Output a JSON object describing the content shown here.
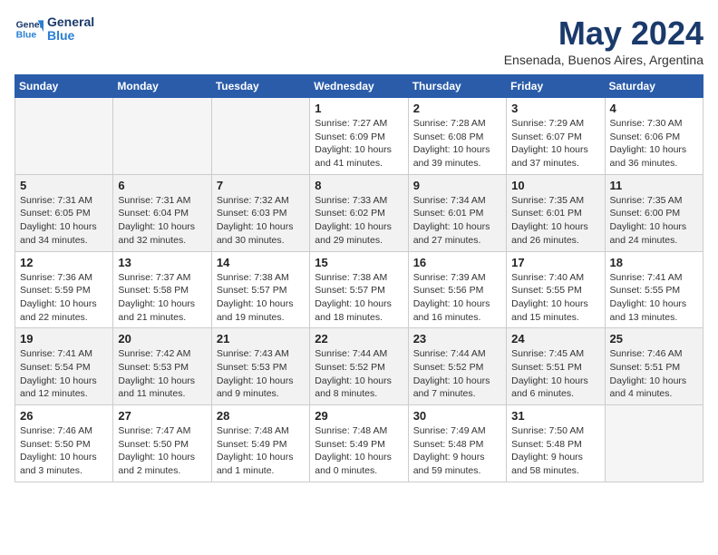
{
  "logo": {
    "text_general": "General",
    "text_blue": "Blue"
  },
  "title": "May 2024",
  "subtitle": "Ensenada, Buenos Aires, Argentina",
  "days_of_week": [
    "Sunday",
    "Monday",
    "Tuesday",
    "Wednesday",
    "Thursday",
    "Friday",
    "Saturday"
  ],
  "weeks": [
    {
      "alt": false,
      "days": [
        {
          "num": "",
          "info": ""
        },
        {
          "num": "",
          "info": ""
        },
        {
          "num": "",
          "info": ""
        },
        {
          "num": "1",
          "info": "Sunrise: 7:27 AM\nSunset: 6:09 PM\nDaylight: 10 hours\nand 41 minutes."
        },
        {
          "num": "2",
          "info": "Sunrise: 7:28 AM\nSunset: 6:08 PM\nDaylight: 10 hours\nand 39 minutes."
        },
        {
          "num": "3",
          "info": "Sunrise: 7:29 AM\nSunset: 6:07 PM\nDaylight: 10 hours\nand 37 minutes."
        },
        {
          "num": "4",
          "info": "Sunrise: 7:30 AM\nSunset: 6:06 PM\nDaylight: 10 hours\nand 36 minutes."
        }
      ]
    },
    {
      "alt": true,
      "days": [
        {
          "num": "5",
          "info": "Sunrise: 7:31 AM\nSunset: 6:05 PM\nDaylight: 10 hours\nand 34 minutes."
        },
        {
          "num": "6",
          "info": "Sunrise: 7:31 AM\nSunset: 6:04 PM\nDaylight: 10 hours\nand 32 minutes."
        },
        {
          "num": "7",
          "info": "Sunrise: 7:32 AM\nSunset: 6:03 PM\nDaylight: 10 hours\nand 30 minutes."
        },
        {
          "num": "8",
          "info": "Sunrise: 7:33 AM\nSunset: 6:02 PM\nDaylight: 10 hours\nand 29 minutes."
        },
        {
          "num": "9",
          "info": "Sunrise: 7:34 AM\nSunset: 6:01 PM\nDaylight: 10 hours\nand 27 minutes."
        },
        {
          "num": "10",
          "info": "Sunrise: 7:35 AM\nSunset: 6:01 PM\nDaylight: 10 hours\nand 26 minutes."
        },
        {
          "num": "11",
          "info": "Sunrise: 7:35 AM\nSunset: 6:00 PM\nDaylight: 10 hours\nand 24 minutes."
        }
      ]
    },
    {
      "alt": false,
      "days": [
        {
          "num": "12",
          "info": "Sunrise: 7:36 AM\nSunset: 5:59 PM\nDaylight: 10 hours\nand 22 minutes."
        },
        {
          "num": "13",
          "info": "Sunrise: 7:37 AM\nSunset: 5:58 PM\nDaylight: 10 hours\nand 21 minutes."
        },
        {
          "num": "14",
          "info": "Sunrise: 7:38 AM\nSunset: 5:57 PM\nDaylight: 10 hours\nand 19 minutes."
        },
        {
          "num": "15",
          "info": "Sunrise: 7:38 AM\nSunset: 5:57 PM\nDaylight: 10 hours\nand 18 minutes."
        },
        {
          "num": "16",
          "info": "Sunrise: 7:39 AM\nSunset: 5:56 PM\nDaylight: 10 hours\nand 16 minutes."
        },
        {
          "num": "17",
          "info": "Sunrise: 7:40 AM\nSunset: 5:55 PM\nDaylight: 10 hours\nand 15 minutes."
        },
        {
          "num": "18",
          "info": "Sunrise: 7:41 AM\nSunset: 5:55 PM\nDaylight: 10 hours\nand 13 minutes."
        }
      ]
    },
    {
      "alt": true,
      "days": [
        {
          "num": "19",
          "info": "Sunrise: 7:41 AM\nSunset: 5:54 PM\nDaylight: 10 hours\nand 12 minutes."
        },
        {
          "num": "20",
          "info": "Sunrise: 7:42 AM\nSunset: 5:53 PM\nDaylight: 10 hours\nand 11 minutes."
        },
        {
          "num": "21",
          "info": "Sunrise: 7:43 AM\nSunset: 5:53 PM\nDaylight: 10 hours\nand 9 minutes."
        },
        {
          "num": "22",
          "info": "Sunrise: 7:44 AM\nSunset: 5:52 PM\nDaylight: 10 hours\nand 8 minutes."
        },
        {
          "num": "23",
          "info": "Sunrise: 7:44 AM\nSunset: 5:52 PM\nDaylight: 10 hours\nand 7 minutes."
        },
        {
          "num": "24",
          "info": "Sunrise: 7:45 AM\nSunset: 5:51 PM\nDaylight: 10 hours\nand 6 minutes."
        },
        {
          "num": "25",
          "info": "Sunrise: 7:46 AM\nSunset: 5:51 PM\nDaylight: 10 hours\nand 4 minutes."
        }
      ]
    },
    {
      "alt": false,
      "days": [
        {
          "num": "26",
          "info": "Sunrise: 7:46 AM\nSunset: 5:50 PM\nDaylight: 10 hours\nand 3 minutes."
        },
        {
          "num": "27",
          "info": "Sunrise: 7:47 AM\nSunset: 5:50 PM\nDaylight: 10 hours\nand 2 minutes."
        },
        {
          "num": "28",
          "info": "Sunrise: 7:48 AM\nSunset: 5:49 PM\nDaylight: 10 hours\nand 1 minute."
        },
        {
          "num": "29",
          "info": "Sunrise: 7:48 AM\nSunset: 5:49 PM\nDaylight: 10 hours\nand 0 minutes."
        },
        {
          "num": "30",
          "info": "Sunrise: 7:49 AM\nSunset: 5:48 PM\nDaylight: 9 hours\nand 59 minutes."
        },
        {
          "num": "31",
          "info": "Sunrise: 7:50 AM\nSunset: 5:48 PM\nDaylight: 9 hours\nand 58 minutes."
        },
        {
          "num": "",
          "info": ""
        }
      ]
    }
  ]
}
